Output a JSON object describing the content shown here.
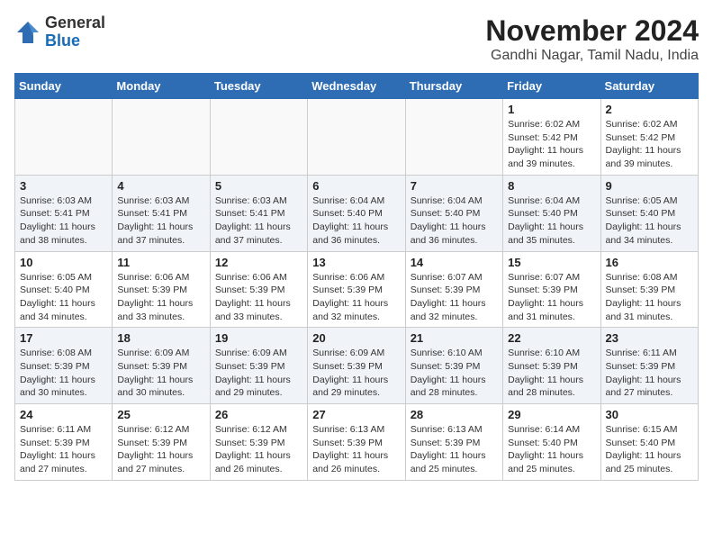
{
  "logo": {
    "general": "General",
    "blue": "Blue"
  },
  "title": "November 2024",
  "subtitle": "Gandhi Nagar, Tamil Nadu, India",
  "days_of_week": [
    "Sunday",
    "Monday",
    "Tuesday",
    "Wednesday",
    "Thursday",
    "Friday",
    "Saturday"
  ],
  "weeks": [
    [
      {
        "day": "",
        "info": ""
      },
      {
        "day": "",
        "info": ""
      },
      {
        "day": "",
        "info": ""
      },
      {
        "day": "",
        "info": ""
      },
      {
        "day": "",
        "info": ""
      },
      {
        "day": "1",
        "info": "Sunrise: 6:02 AM\nSunset: 5:42 PM\nDaylight: 11 hours and 39 minutes."
      },
      {
        "day": "2",
        "info": "Sunrise: 6:02 AM\nSunset: 5:42 PM\nDaylight: 11 hours and 39 minutes."
      }
    ],
    [
      {
        "day": "3",
        "info": "Sunrise: 6:03 AM\nSunset: 5:41 PM\nDaylight: 11 hours and 38 minutes."
      },
      {
        "day": "4",
        "info": "Sunrise: 6:03 AM\nSunset: 5:41 PM\nDaylight: 11 hours and 37 minutes."
      },
      {
        "day": "5",
        "info": "Sunrise: 6:03 AM\nSunset: 5:41 PM\nDaylight: 11 hours and 37 minutes."
      },
      {
        "day": "6",
        "info": "Sunrise: 6:04 AM\nSunset: 5:40 PM\nDaylight: 11 hours and 36 minutes."
      },
      {
        "day": "7",
        "info": "Sunrise: 6:04 AM\nSunset: 5:40 PM\nDaylight: 11 hours and 36 minutes."
      },
      {
        "day": "8",
        "info": "Sunrise: 6:04 AM\nSunset: 5:40 PM\nDaylight: 11 hours and 35 minutes."
      },
      {
        "day": "9",
        "info": "Sunrise: 6:05 AM\nSunset: 5:40 PM\nDaylight: 11 hours and 34 minutes."
      }
    ],
    [
      {
        "day": "10",
        "info": "Sunrise: 6:05 AM\nSunset: 5:40 PM\nDaylight: 11 hours and 34 minutes."
      },
      {
        "day": "11",
        "info": "Sunrise: 6:06 AM\nSunset: 5:39 PM\nDaylight: 11 hours and 33 minutes."
      },
      {
        "day": "12",
        "info": "Sunrise: 6:06 AM\nSunset: 5:39 PM\nDaylight: 11 hours and 33 minutes."
      },
      {
        "day": "13",
        "info": "Sunrise: 6:06 AM\nSunset: 5:39 PM\nDaylight: 11 hours and 32 minutes."
      },
      {
        "day": "14",
        "info": "Sunrise: 6:07 AM\nSunset: 5:39 PM\nDaylight: 11 hours and 32 minutes."
      },
      {
        "day": "15",
        "info": "Sunrise: 6:07 AM\nSunset: 5:39 PM\nDaylight: 11 hours and 31 minutes."
      },
      {
        "day": "16",
        "info": "Sunrise: 6:08 AM\nSunset: 5:39 PM\nDaylight: 11 hours and 31 minutes."
      }
    ],
    [
      {
        "day": "17",
        "info": "Sunrise: 6:08 AM\nSunset: 5:39 PM\nDaylight: 11 hours and 30 minutes."
      },
      {
        "day": "18",
        "info": "Sunrise: 6:09 AM\nSunset: 5:39 PM\nDaylight: 11 hours and 30 minutes."
      },
      {
        "day": "19",
        "info": "Sunrise: 6:09 AM\nSunset: 5:39 PM\nDaylight: 11 hours and 29 minutes."
      },
      {
        "day": "20",
        "info": "Sunrise: 6:09 AM\nSunset: 5:39 PM\nDaylight: 11 hours and 29 minutes."
      },
      {
        "day": "21",
        "info": "Sunrise: 6:10 AM\nSunset: 5:39 PM\nDaylight: 11 hours and 28 minutes."
      },
      {
        "day": "22",
        "info": "Sunrise: 6:10 AM\nSunset: 5:39 PM\nDaylight: 11 hours and 28 minutes."
      },
      {
        "day": "23",
        "info": "Sunrise: 6:11 AM\nSunset: 5:39 PM\nDaylight: 11 hours and 27 minutes."
      }
    ],
    [
      {
        "day": "24",
        "info": "Sunrise: 6:11 AM\nSunset: 5:39 PM\nDaylight: 11 hours and 27 minutes."
      },
      {
        "day": "25",
        "info": "Sunrise: 6:12 AM\nSunset: 5:39 PM\nDaylight: 11 hours and 27 minutes."
      },
      {
        "day": "26",
        "info": "Sunrise: 6:12 AM\nSunset: 5:39 PM\nDaylight: 11 hours and 26 minutes."
      },
      {
        "day": "27",
        "info": "Sunrise: 6:13 AM\nSunset: 5:39 PM\nDaylight: 11 hours and 26 minutes."
      },
      {
        "day": "28",
        "info": "Sunrise: 6:13 AM\nSunset: 5:39 PM\nDaylight: 11 hours and 25 minutes."
      },
      {
        "day": "29",
        "info": "Sunrise: 6:14 AM\nSunset: 5:40 PM\nDaylight: 11 hours and 25 minutes."
      },
      {
        "day": "30",
        "info": "Sunrise: 6:15 AM\nSunset: 5:40 PM\nDaylight: 11 hours and 25 minutes."
      }
    ]
  ]
}
